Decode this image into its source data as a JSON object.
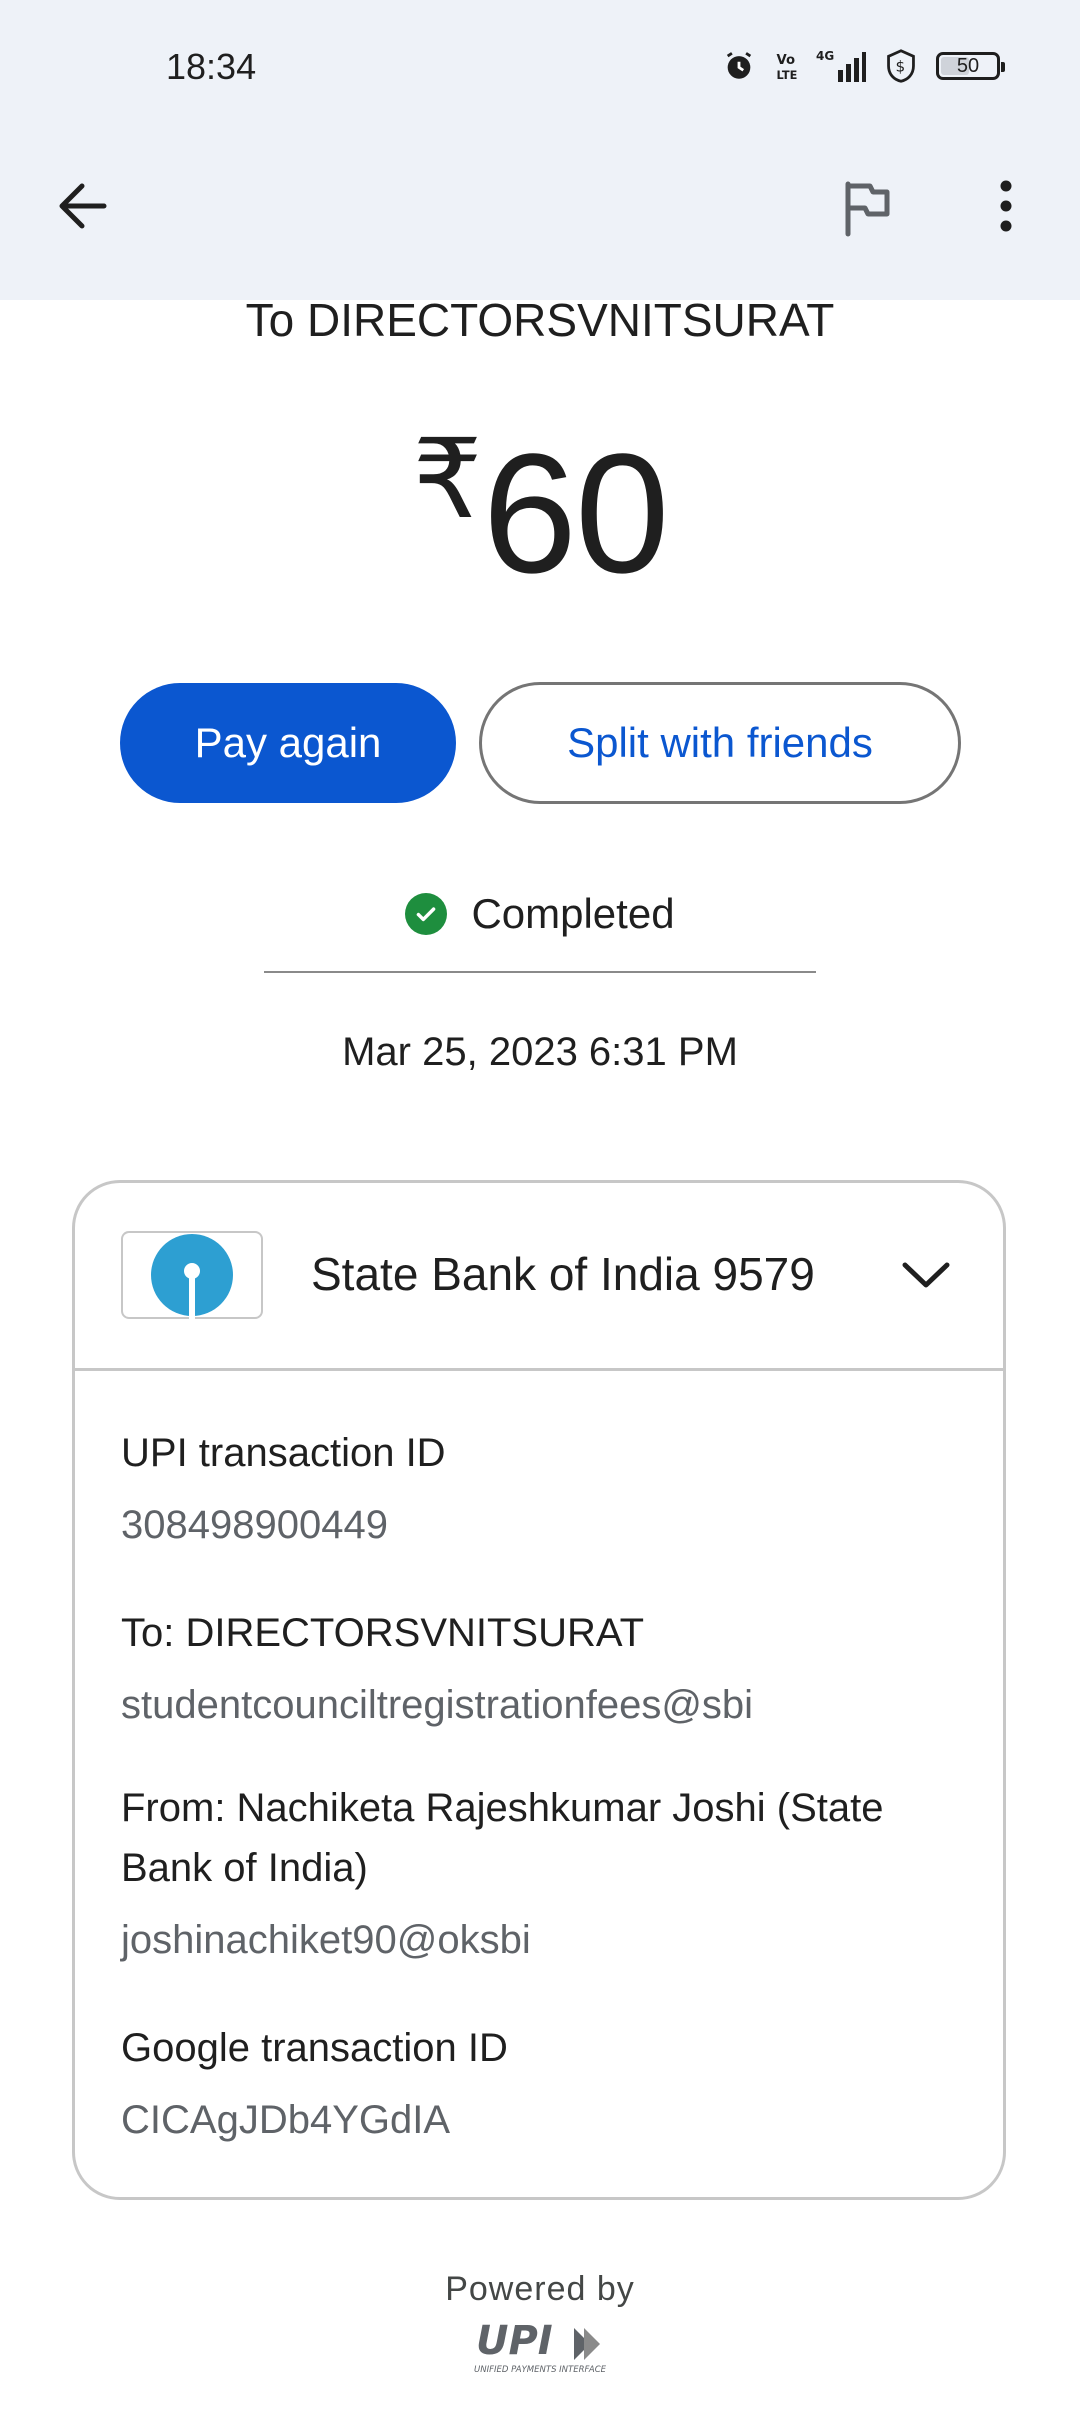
{
  "status_bar": {
    "time": "18:34",
    "battery": "50",
    "icons": [
      "alarm-icon",
      "volte-icon",
      "4g-signal-icon",
      "shield-icon",
      "battery-icon"
    ]
  },
  "app_bar": {
    "back_icon": "arrow-back-icon",
    "flag_icon": "flag-icon",
    "more_icon": "more-vert-icon"
  },
  "payment": {
    "recipient_line": "To DIRECTORSVNITSURAT",
    "currency_symbol": "₹",
    "amount": "60",
    "pay_again_label": "Pay again",
    "split_label": "Split with friends",
    "status": "Completed",
    "datetime": "Mar 25, 2023 6:31 PM"
  },
  "details_card": {
    "bank_name": "State Bank of India 9579",
    "items": [
      {
        "label": "UPI transaction ID",
        "value": "308498900449"
      },
      {
        "label": "To: DIRECTORSVNITSURAT",
        "value": "studentcounciltregistrationfees@sbi"
      },
      {
        "label": "From: Nachiketa Rajeshkumar Joshi (State Bank of India)",
        "value": "joshinachiket90@oksbi"
      },
      {
        "label": "Google transaction ID",
        "value": "CICAgJDb4YGdIA"
      }
    ]
  },
  "footer": {
    "powered_by": "Powered by",
    "upi_text": "UPI",
    "upi_subtext": "UNIFIED PAYMENTS INTERFACE"
  },
  "colors": {
    "primary": "#0b57d0",
    "success": "#1e8e3e",
    "topbar_bg": "#eef2f8"
  }
}
